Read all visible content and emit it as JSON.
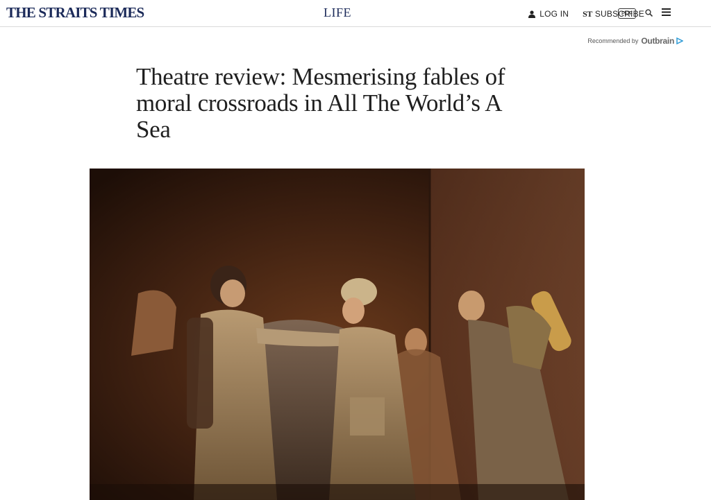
{
  "header": {
    "logo": "THE STRAITS TIMES",
    "section": "LIFE",
    "login_label": "LOG IN",
    "subscribe_mark": "ST",
    "subscribe_label": "SUBSCRIBE",
    "pdf_label": "PDF"
  },
  "recommendation": {
    "label": "Recommended by",
    "brand": "Outbrain"
  },
  "article": {
    "headline": "Theatre review: Mesmerising fables of moral crossroads in All The World’s A Sea"
  },
  "colors": {
    "brand_navy": "#1b2a59",
    "stage_warm": "#7a4420"
  },
  "icons": [
    "user-icon",
    "search-icon",
    "menu-icon",
    "outbrain-arrow-icon"
  ]
}
